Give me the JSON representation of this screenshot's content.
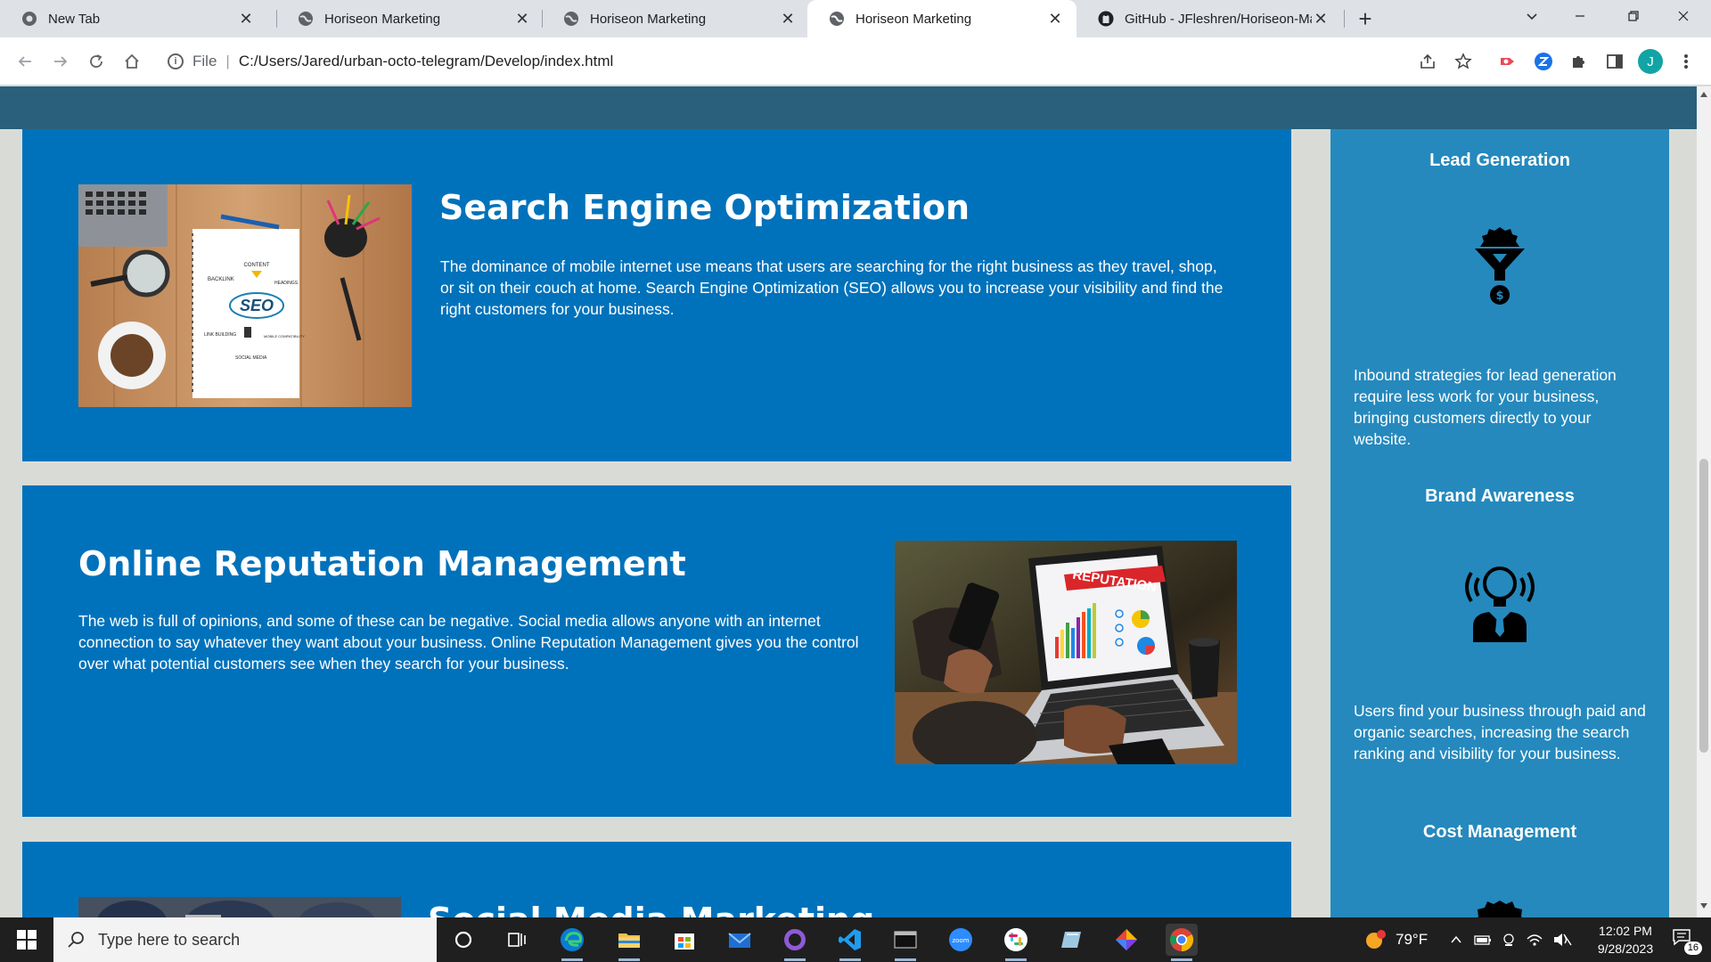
{
  "browser": {
    "tabs": [
      {
        "title": "New Tab",
        "icon": "chrome-icon",
        "active": false
      },
      {
        "title": "Horiseon Marketing",
        "icon": "globe-icon",
        "active": false
      },
      {
        "title": "Horiseon Marketing",
        "icon": "globe-icon",
        "active": false
      },
      {
        "title": "Horiseon Marketing",
        "icon": "globe-icon",
        "active": true
      },
      {
        "title": "GitHub - JFleshren/Horiseon-Marketing",
        "icon": "github-icon",
        "active": false
      }
    ],
    "address": {
      "scheme": "File",
      "path": "C:/Users/Jared/urban-octo-telegram/Develop/index.html"
    },
    "profile_initial": "J"
  },
  "content": {
    "cards": [
      {
        "title": "Search Engine Optimization",
        "text": "The dominance of mobile internet use means that users are searching for the right business as they travel, shop, or sit on their couch at home. Search Engine Optimization (SEO) allows you to increase your visibility and find the right customers for your business.",
        "image_labels": {
          "center": "SEO",
          "content": "CONTENT",
          "backlink": "BACKLINK",
          "headings": "HEADINGS",
          "link_building": "LINK BUILDING",
          "mobile": "MOBILE COMPATIBILITY",
          "social": "SOCIAL MEDIA"
        }
      },
      {
        "title": "Online Reputation Management",
        "text": "The web is full of opinions, and some of these can be negative. Social media allows anyone with an internet connection to say whatever they want about your business. Online Reputation Management gives you the control over what potential customers see when they search for your business.",
        "image_labels": {
          "banner": "REPUTATION"
        }
      },
      {
        "title": "Social Media Marketing"
      }
    ],
    "benefits": [
      {
        "title": "Lead Generation",
        "icon": "lead-funnel-icon",
        "text": "Inbound strategies for lead generation require less work for your business, bringing customers directly to your website."
      },
      {
        "title": "Brand Awareness",
        "icon": "brand-lightbulb-icon",
        "text": "Users find your business through paid and organic searches, increasing the search ranking and visibility for your business."
      },
      {
        "title": "Cost Management",
        "icon": "cost-gear-icon"
      }
    ]
  },
  "taskbar": {
    "search_placeholder": "Type here to search",
    "weather": "79°F",
    "time": "12:02 PM",
    "date": "9/28/2023",
    "notifications": "16"
  },
  "colors": {
    "card_blue": "#0072bb",
    "sidebar_blue": "#2589bd",
    "header": "#2a607c",
    "page_bg": "#d9dcd6"
  }
}
